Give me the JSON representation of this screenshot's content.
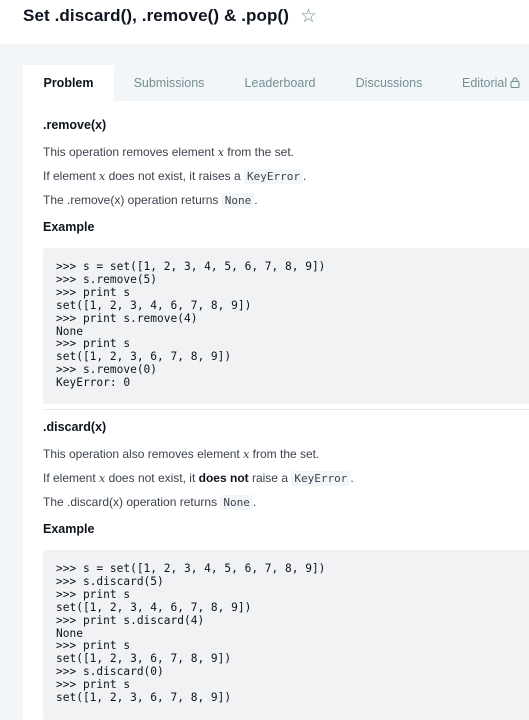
{
  "page": {
    "title": "Set .discard(), .remove() & .pop()"
  },
  "tabs": [
    {
      "label": "Problem"
    },
    {
      "label": "Submissions"
    },
    {
      "label": "Leaderboard"
    },
    {
      "label": "Discussions"
    },
    {
      "label": "Editorial"
    }
  ],
  "remove": {
    "heading": ".remove(x)",
    "line1_pre": "This operation removes element ",
    "line1_var": "x",
    "line1_post": " from the set.",
    "line2_pre": "If element ",
    "line2_var": "x",
    "line2_mid": " does not exist, it raises a ",
    "line2_code": "KeyError",
    "line2_post": ".",
    "line3_pre": "The .remove(x) operation returns ",
    "line3_code": "None",
    "line3_post": ".",
    "example_heading": "Example",
    "code": ">>> s = set([1, 2, 3, 4, 5, 6, 7, 8, 9])\n>>> s.remove(5)\n>>> print s\nset([1, 2, 3, 4, 6, 7, 8, 9])\n>>> print s.remove(4)\nNone\n>>> print s\nset([1, 2, 3, 6, 7, 8, 9])\n>>> s.remove(0)\nKeyError: 0"
  },
  "discard": {
    "heading": ".discard(x)",
    "line1_pre": "This operation also removes element ",
    "line1_var": "x",
    "line1_post": " from the set.",
    "line2_pre": "If element ",
    "line2_var": "x",
    "line2_mid": " does not exist, it ",
    "line2_bold": "does not",
    "line2_mid2": " raise a ",
    "line2_code": "KeyError",
    "line2_post": ".",
    "line3_pre": "The .discard(x) operation returns ",
    "line3_code": "None",
    "line3_post": ".",
    "example_heading": "Example",
    "code": ">>> s = set([1, 2, 3, 4, 5, 6, 7, 8, 9])\n>>> s.discard(5)\n>>> print s\nset([1, 2, 3, 4, 6, 7, 8, 9])\n>>> print s.discard(4)\nNone\n>>> print s\nset([1, 2, 3, 6, 7, 8, 9])\n>>> s.discard(0)\n>>> print s\nset([1, 2, 3, 6, 7, 8, 9])"
  }
}
